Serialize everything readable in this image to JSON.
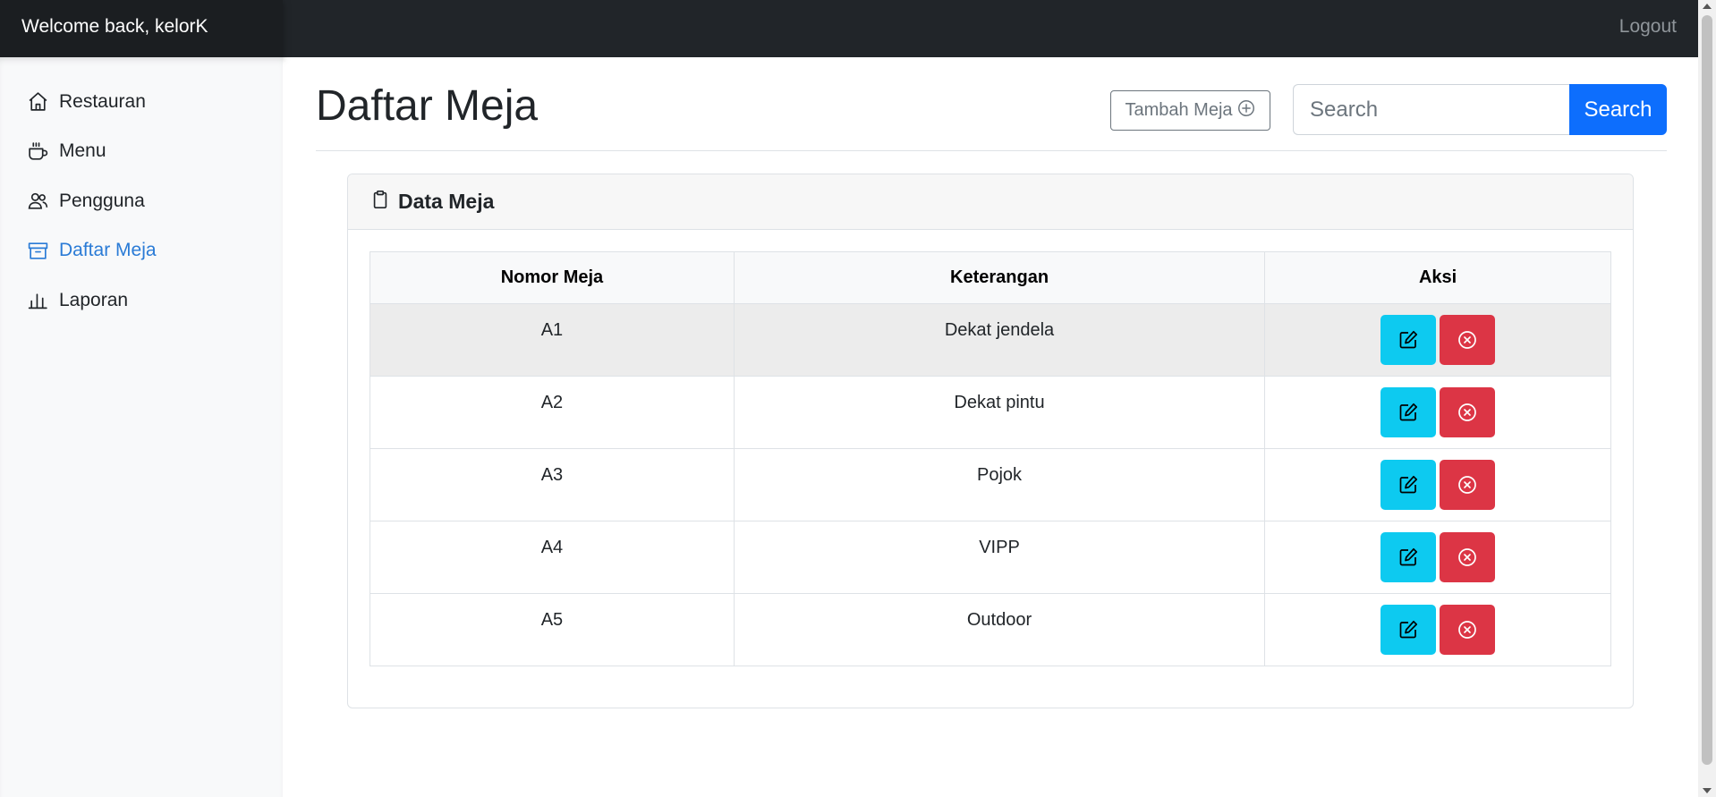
{
  "header": {
    "welcome": "Welcome back, kelorK",
    "logout": "Logout"
  },
  "sidebar": {
    "items": [
      {
        "label": "Restauran",
        "icon": "house-icon",
        "active": false
      },
      {
        "label": "Menu",
        "icon": "cup-icon",
        "active": false
      },
      {
        "label": "Pengguna",
        "icon": "people-icon",
        "active": false
      },
      {
        "label": "Daftar Meja",
        "icon": "archive-icon",
        "active": true
      },
      {
        "label": "Laporan",
        "icon": "bar-chart-icon",
        "active": false
      }
    ]
  },
  "main": {
    "title": "Daftar Meja",
    "add_button": "Tambah Meja",
    "search": {
      "placeholder": "Search",
      "value": "",
      "button": "Search"
    },
    "card": {
      "title": "Data Meja",
      "icon": "clipboard-icon"
    },
    "table": {
      "columns": [
        "Nomor Meja",
        "Keterangan",
        "Aksi"
      ],
      "rows": [
        {
          "nomor": "A1",
          "keterangan": "Dekat jendela"
        },
        {
          "nomor": "A2",
          "keterangan": "Dekat pintu"
        },
        {
          "nomor": "A3",
          "keterangan": "Pojok"
        },
        {
          "nomor": "A4",
          "keterangan": "VIPP"
        },
        {
          "nomor": "A5",
          "keterangan": "Outdoor"
        }
      ]
    }
  },
  "colors": {
    "topbar": "#212529",
    "active_nav": "#2a7bd6",
    "primary": "#0d6efd",
    "edit": "#0dcaf0",
    "delete": "#dc3545"
  }
}
